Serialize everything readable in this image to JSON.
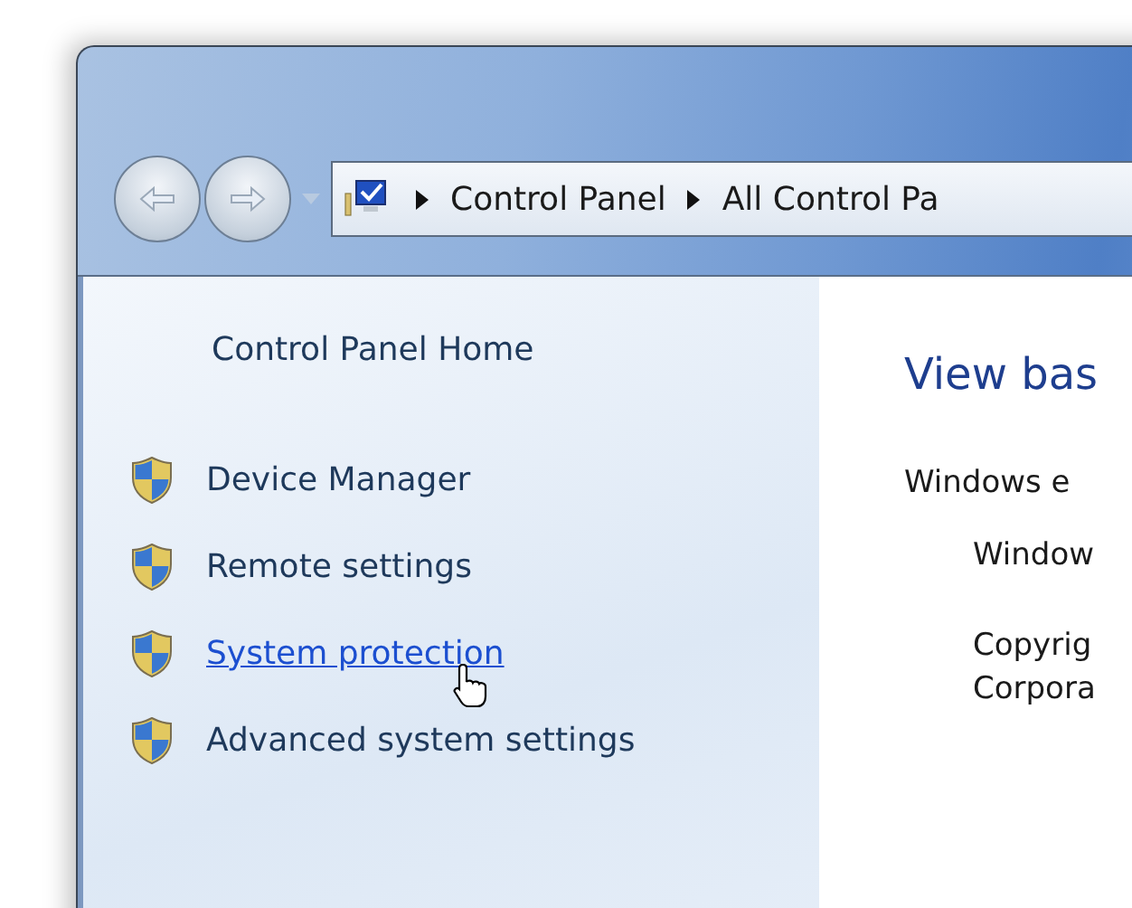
{
  "address_bar": {
    "crumbs": [
      "Control Panel",
      "All Control Pa"
    ]
  },
  "sidebar": {
    "home_link": "Control Panel Home",
    "items": [
      {
        "label": "Device Manager",
        "hovered": false
      },
      {
        "label": "Remote settings",
        "hovered": false
      },
      {
        "label": "System protection",
        "hovered": true
      },
      {
        "label": "Advanced system settings",
        "hovered": false
      }
    ]
  },
  "main": {
    "heading": "View bas",
    "section_label": "Windows e",
    "lines": [
      "Window",
      "Copyrig",
      "Corpora"
    ]
  }
}
